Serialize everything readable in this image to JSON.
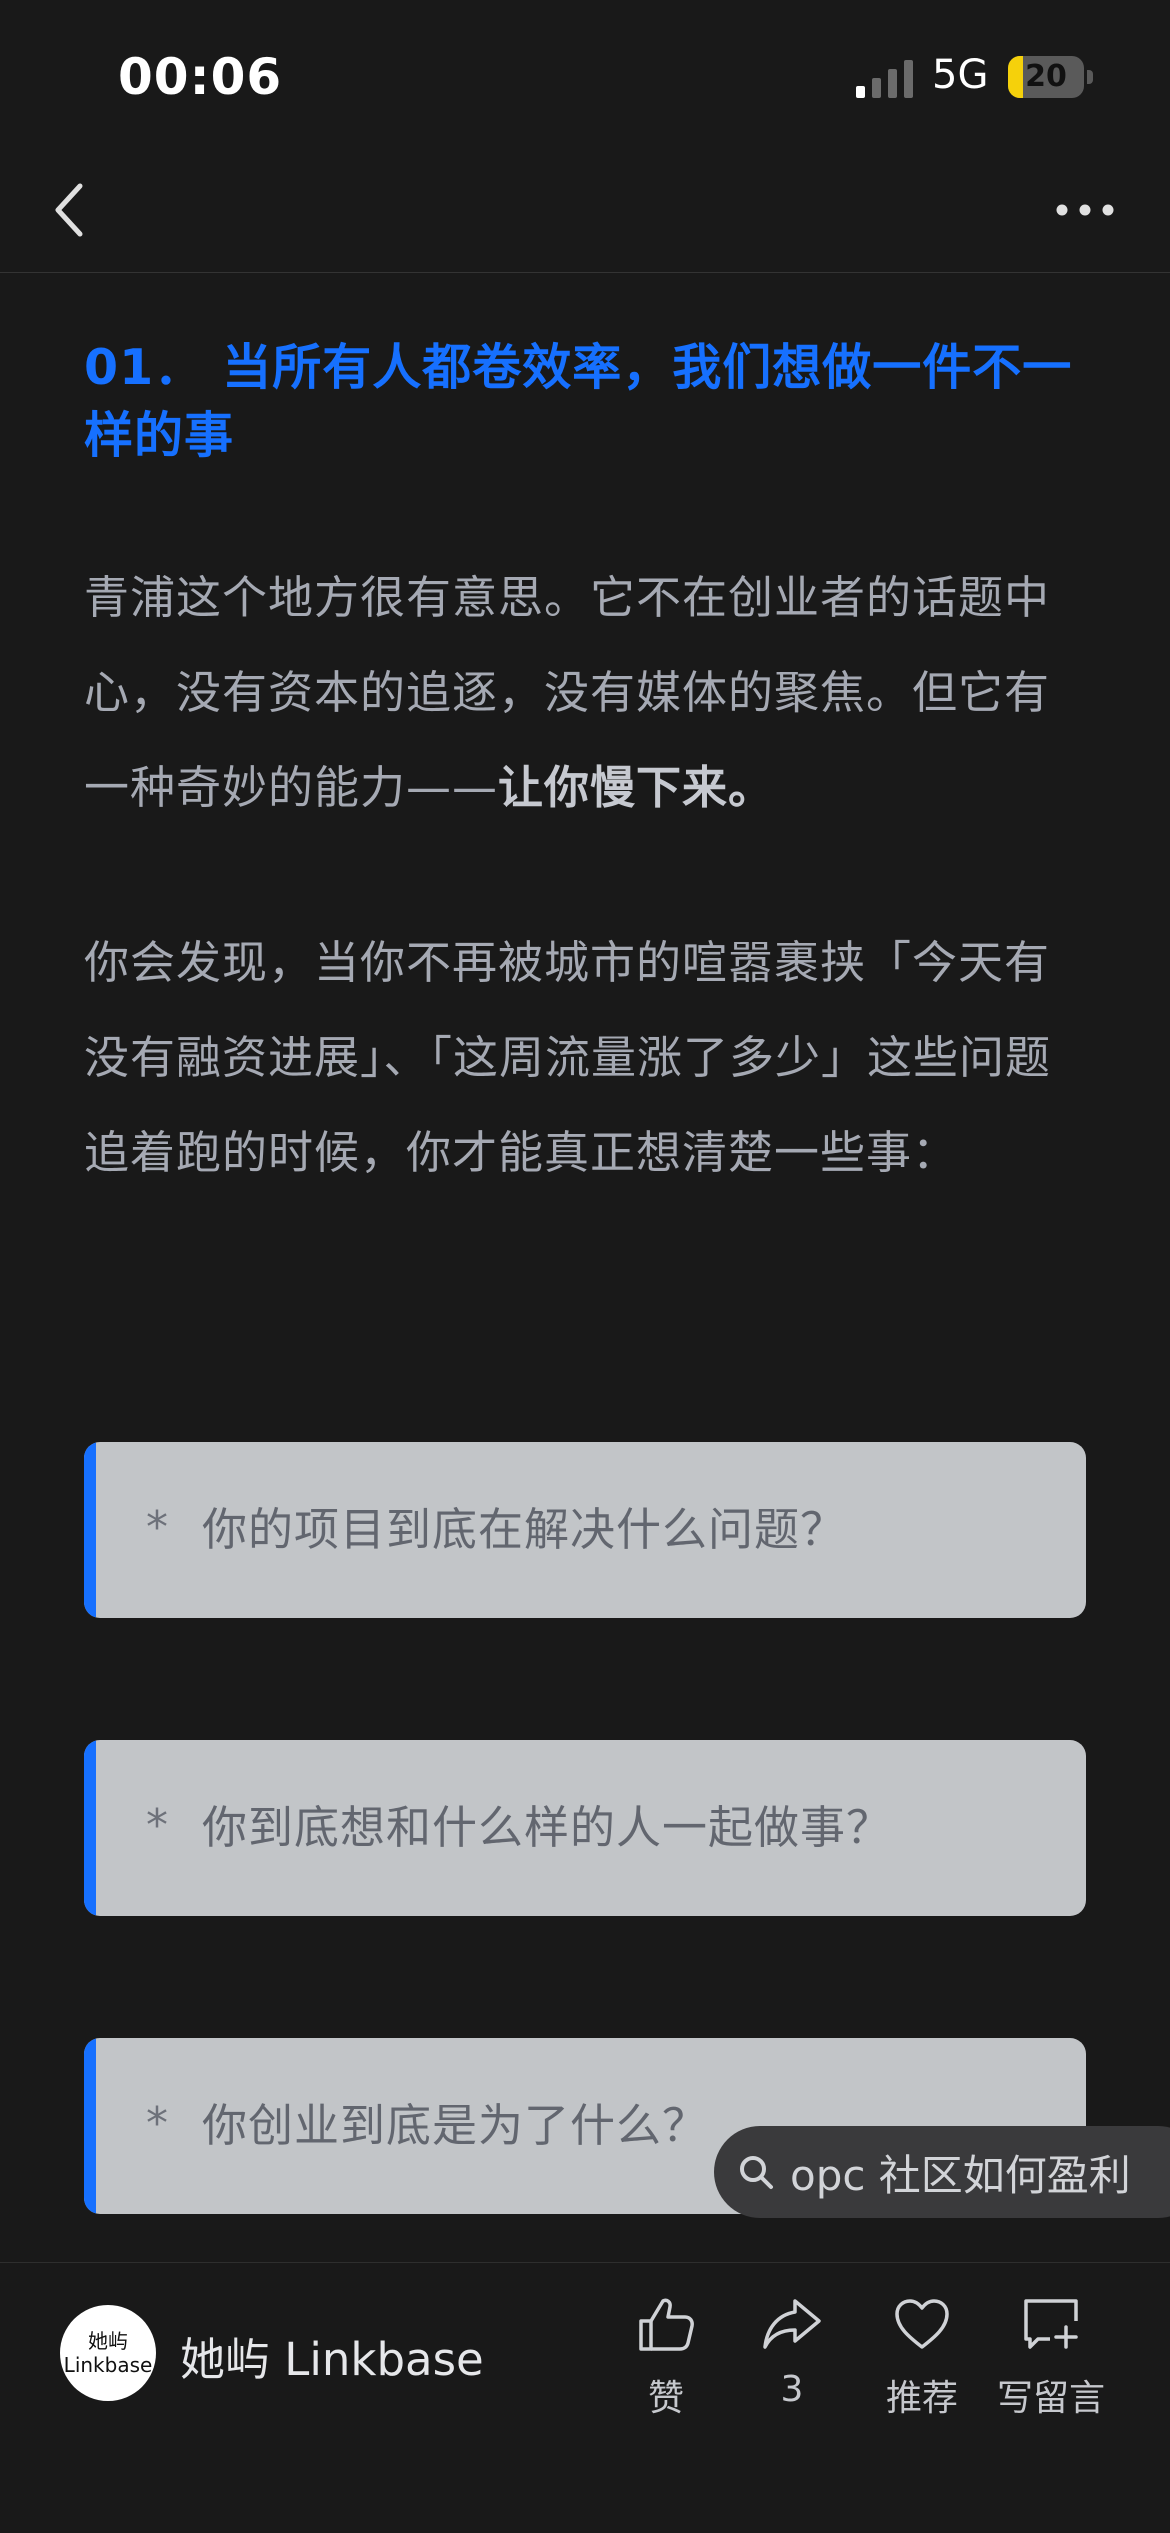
{
  "status": {
    "time": "00:06",
    "network": "5G",
    "battery": "20",
    "battery_level": 0.2
  },
  "article": {
    "heading": "01． 当所有人都卷效率，我们想做一件不一样的事",
    "p1_text": "青浦这个地方很有意思。它不在创业者的话题中心，没有资本的追逐，没有媒体的聚焦。但它有一种奇妙的能力——",
    "p1_bold": "让你慢下来。",
    "p2_text": "你会发现，当你不再被城市的喧嚣裹挟「今天有没有融资进展」、「这周流量涨了多少」这些问题追着跑的时候，你才能真正想清楚一些事：",
    "quotes": [
      {
        "bullet": "*",
        "text": "你的项目到底在解决什么问题？"
      },
      {
        "bullet": "*",
        "text": "你到底想和什么样的人一起做事？"
      },
      {
        "bullet": "*",
        "text": "你创业到底是为了什么？"
      }
    ]
  },
  "search_suggestion": {
    "text": "opc 社区如何盈利",
    "icon": "search-icon"
  },
  "footer": {
    "avatar_line1": "她屿",
    "avatar_line2": "Linkbase",
    "account_name": "她屿 Linkbase",
    "actions": {
      "like": "赞",
      "share": "3",
      "recommend": "推荐",
      "comment": "写留言"
    }
  },
  "colors": {
    "accent": "#1670ff",
    "background": "#191919",
    "quote_bg": "#c2c5c8"
  }
}
